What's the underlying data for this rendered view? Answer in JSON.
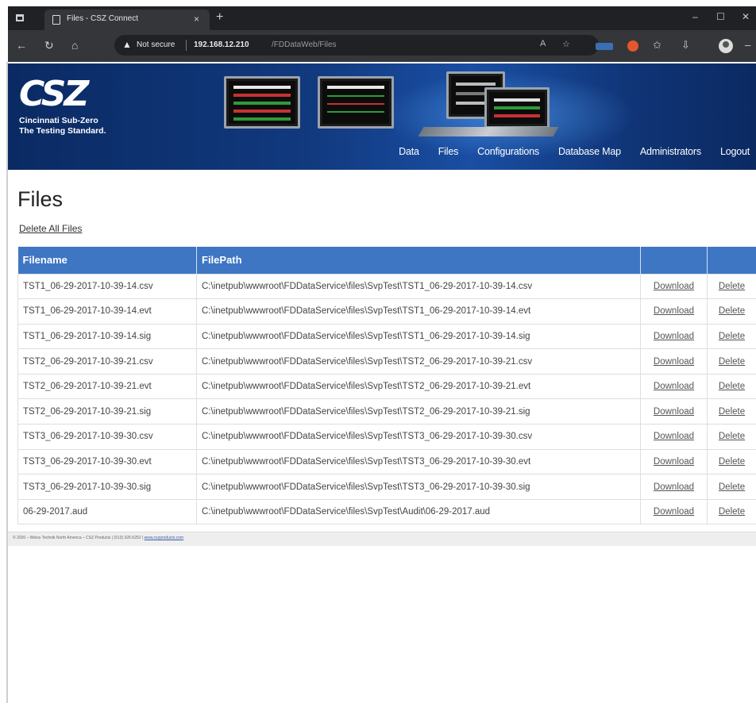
{
  "browser": {
    "tab_title": "Files - CSZ Connect",
    "tab_close": "×",
    "new_tab": "+",
    "security_label": "Not secure",
    "url_host": "192.168.12.210",
    "url_path": "/FDDataWeb/Files",
    "window_controls": [
      "–",
      "☐",
      "✕"
    ]
  },
  "header": {
    "logo_text": "CSZ",
    "logo_line1": "Cincinnati Sub-Zero",
    "logo_line2": "The Testing Standard.",
    "nav": [
      "Data",
      "Files",
      "Configurations",
      "Database Map",
      "Administrators",
      "Logout"
    ]
  },
  "page": {
    "title": "Files",
    "delete_all": "Delete All Files"
  },
  "table": {
    "headers": [
      "Filename",
      "FilePath",
      "",
      ""
    ],
    "download_label": "Download",
    "delete_label": "Delete",
    "rows": [
      {
        "filename": "TST1_06-29-2017-10-39-14.csv",
        "path": "C:\\inetpub\\wwwroot\\FDDataService\\files\\SvpTest\\TST1_06-29-2017-10-39-14.csv"
      },
      {
        "filename": "TST1_06-29-2017-10-39-14.evt",
        "path": "C:\\inetpub\\wwwroot\\FDDataService\\files\\SvpTest\\TST1_06-29-2017-10-39-14.evt"
      },
      {
        "filename": "TST1_06-29-2017-10-39-14.sig",
        "path": "C:\\inetpub\\wwwroot\\FDDataService\\files\\SvpTest\\TST1_06-29-2017-10-39-14.sig"
      },
      {
        "filename": "TST2_06-29-2017-10-39-21.csv",
        "path": "C:\\inetpub\\wwwroot\\FDDataService\\files\\SvpTest\\TST2_06-29-2017-10-39-21.csv"
      },
      {
        "filename": "TST2_06-29-2017-10-39-21.evt",
        "path": "C:\\inetpub\\wwwroot\\FDDataService\\files\\SvpTest\\TST2_06-29-2017-10-39-21.evt"
      },
      {
        "filename": "TST2_06-29-2017-10-39-21.sig",
        "path": "C:\\inetpub\\wwwroot\\FDDataService\\files\\SvpTest\\TST2_06-29-2017-10-39-21.sig"
      },
      {
        "filename": "TST3_06-29-2017-10-39-30.csv",
        "path": "C:\\inetpub\\wwwroot\\FDDataService\\files\\SvpTest\\TST3_06-29-2017-10-39-30.csv"
      },
      {
        "filename": "TST3_06-29-2017-10-39-30.evt",
        "path": "C:\\inetpub\\wwwroot\\FDDataService\\files\\SvpTest\\TST3_06-29-2017-10-39-30.evt"
      },
      {
        "filename": "TST3_06-29-2017-10-39-30.sig",
        "path": "C:\\inetpub\\wwwroot\\FDDataService\\files\\SvpTest\\TST3_06-29-2017-10-39-30.sig"
      },
      {
        "filename": "06-29-2017.aud",
        "path": "C:\\inetpub\\wwwroot\\FDDataService\\files\\SvpTest\\Audit\\06-29-2017.aud"
      }
    ]
  },
  "footer": {
    "text": "© 2020 – Weiss Technik North America – CSZ Products | (513) 326-5252 | ",
    "link": "www.cszproducts.com"
  },
  "colors": {
    "header_blue": "#0f3374",
    "table_header": "#3f76c3"
  }
}
